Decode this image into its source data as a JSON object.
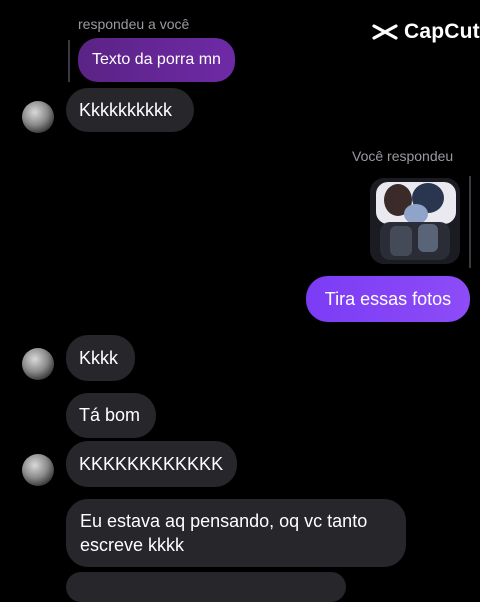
{
  "watermark": {
    "brand": "CapCut"
  },
  "messages": {
    "reply_label_in": "respondeu a você",
    "quoted_text": "Texto da porra mn",
    "msg1": "Kkkkkkkkkk",
    "reply_label_out": "Você respondeu",
    "attachment_icon": "photo-thumbnail",
    "out_msg": "Tira essas fotos",
    "msg2": "Kkkk",
    "msg3": "Tá bom",
    "msg4": "KKKKKKKKKKKK",
    "msg5": "Eu estava aq pensando, oq vc tanto\nescreve kkkk"
  },
  "colors": {
    "background": "#000000",
    "incoming_bubble": "#26262b",
    "outgoing_bubble": "#7b3cf5",
    "quoted_bubble": "#5b2385"
  }
}
